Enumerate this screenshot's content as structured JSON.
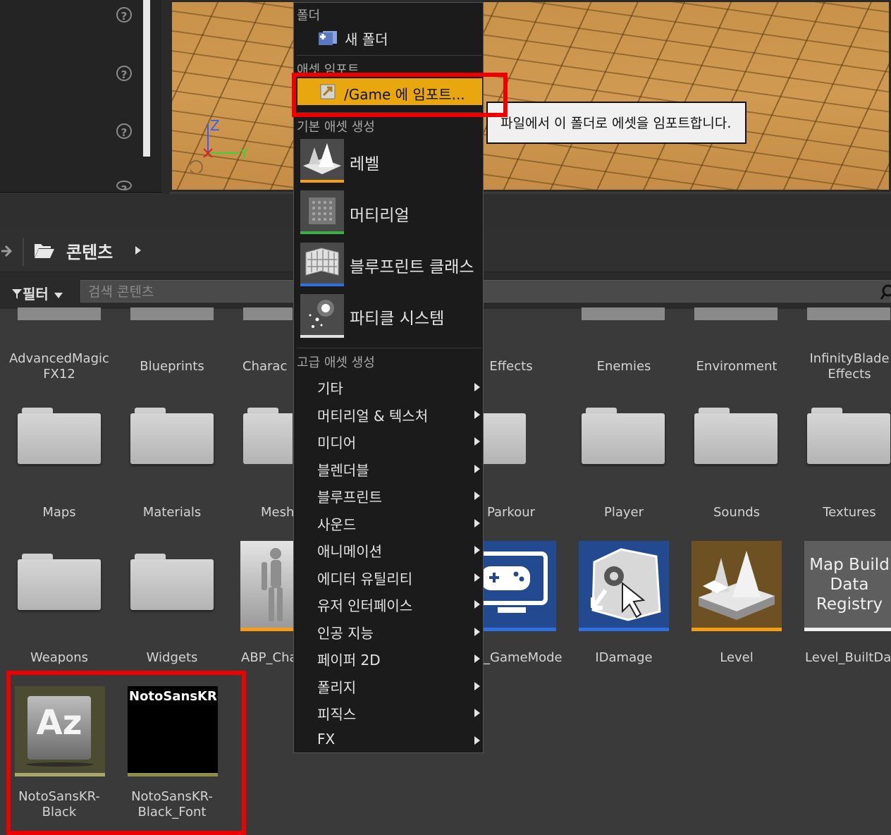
{
  "viewport": {
    "axis_z": "Z",
    "axis_y": "Y"
  },
  "content_browser": {
    "path_root": "콘텐츠",
    "filter_label": "필터",
    "search_placeholder": "검색 콘텐츠",
    "row1": [
      "AdvancedMagic\nFX12",
      "Blueprints",
      "Charac",
      "Effects",
      "Enemies",
      "Environment",
      "InfinityBlade\nEffects"
    ],
    "row2": [
      "Maps",
      "Materials",
      "Mesh",
      "Parkour",
      "Player",
      "Sounds",
      "Textures"
    ],
    "row3": [
      "Weapons",
      "Widgets",
      "ABP_Cha",
      "_GameMode",
      "IDamage",
      "Level",
      "Level_BuiltData"
    ],
    "map_build_thumb_text": "Map Build\nData\nRegistry",
    "row4": [
      "NotoSansKR-\nBlack",
      "NotoSansKR-\nBlack_Font"
    ],
    "font_thumb_text": "NotoSansKR-I",
    "font_icon_text": "Az"
  },
  "context_menu": {
    "folder_header": "폴더",
    "new_folder": "새 폴더",
    "import_header": "애셋 임포트",
    "import_item": "/Game 에 임포트...",
    "basic_header": "기본 애셋 생성",
    "basic_items": [
      "레벨",
      "머티리얼",
      "블루프린트 클래스",
      "파티클 시스템"
    ],
    "advanced_header": "고급 애셋 생성",
    "advanced_items": [
      "기타",
      "머티리얼 & 텍스처",
      "미디어",
      "블렌더블",
      "블루프린트",
      "사운드",
      "애니메이션",
      "에디터 유틸리티",
      "유저 인터페이스",
      "인공 지능",
      "페이퍼 2D",
      "폴리지",
      "피직스",
      "FX"
    ]
  },
  "tooltip": "파일에서 이 폴더로 에셋을 임포트합니다.",
  "colors": {
    "highlight_red": "#ee0000",
    "import_hover": "#e8a70e",
    "level_underline": "#f59d16",
    "material_underline": "#3cb043",
    "blueprint_underline": "#2f6fde"
  }
}
